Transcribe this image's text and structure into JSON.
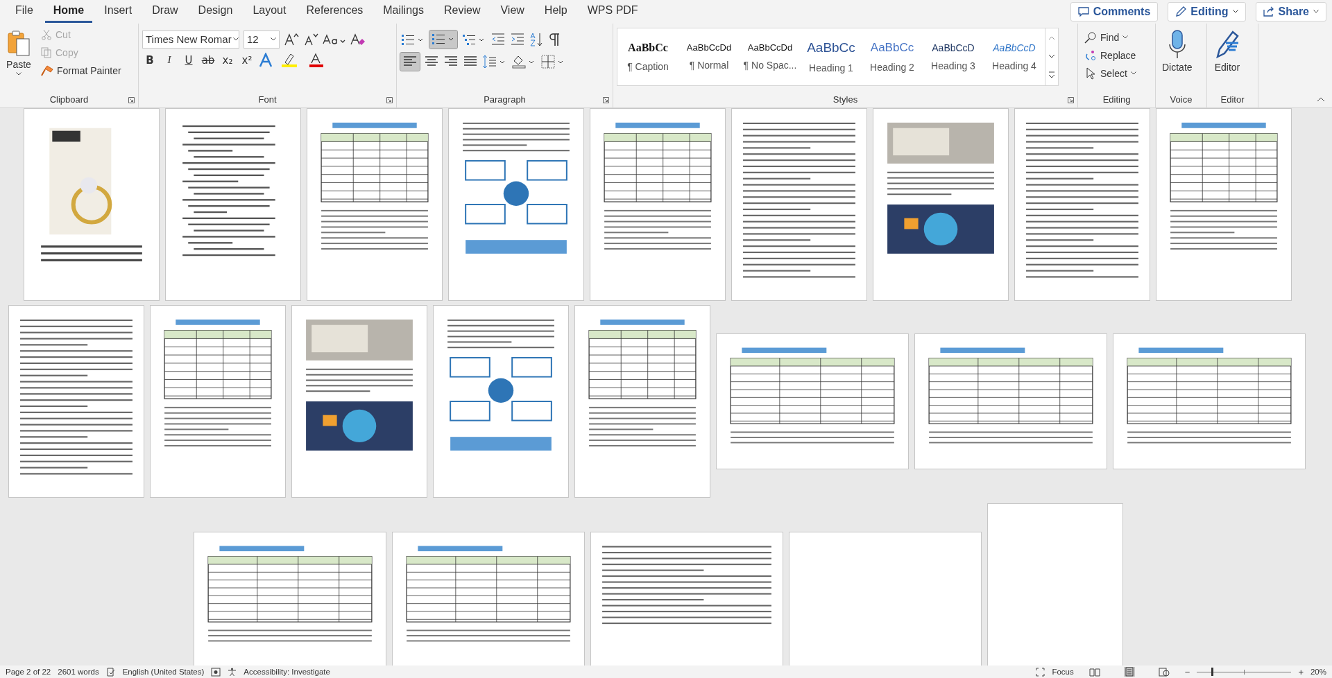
{
  "menu_tabs": [
    {
      "label": "File",
      "selected": false
    },
    {
      "label": "Home",
      "selected": true
    },
    {
      "label": "Insert",
      "selected": false
    },
    {
      "label": "Draw",
      "selected": false
    },
    {
      "label": "Design",
      "selected": false
    },
    {
      "label": "Layout",
      "selected": false
    },
    {
      "label": "References",
      "selected": false
    },
    {
      "label": "Mailings",
      "selected": false
    },
    {
      "label": "Review",
      "selected": false
    },
    {
      "label": "View",
      "selected": false
    },
    {
      "label": "Help",
      "selected": false
    },
    {
      "label": "WPS PDF",
      "selected": false
    }
  ],
  "header_buttons": [
    {
      "kind": "comments",
      "label": "Comments"
    },
    {
      "kind": "editing",
      "label": "Editing"
    },
    {
      "kind": "share",
      "label": "Share"
    }
  ],
  "clipboard": {
    "label": "Clipboard",
    "paste": "Paste",
    "cut": {
      "label": "Cut",
      "disabled": true
    },
    "copy": {
      "label": "Copy",
      "disabled": true
    },
    "format_painter": {
      "label": "Format Painter",
      "disabled": false
    }
  },
  "font": {
    "label": "Font",
    "name": "Times New Romar",
    "size": "12",
    "format_buttons": [
      {
        "kind": "bold",
        "label": "B"
      },
      {
        "kind": "italic",
        "label": "I"
      },
      {
        "kind": "underline",
        "label": "U"
      },
      {
        "kind": "strike",
        "label": "ab"
      },
      {
        "kind": "subscript",
        "label": "x₂"
      },
      {
        "kind": "superscript",
        "label": "x²"
      }
    ]
  },
  "paragraph": {
    "label": "Paragraph",
    "numbering_selected": true,
    "align_left_selected": true
  },
  "styles": {
    "label": "Styles",
    "items": [
      {
        "kind": "caption",
        "preview": "AaBbCc",
        "name": "¶ Caption"
      },
      {
        "kind": "normal",
        "preview": "AaBbCcDd",
        "name": "¶ Normal"
      },
      {
        "kind": "normal",
        "preview": "AaBbCcDd",
        "name": "¶ No Spac..."
      },
      {
        "kind": "heading1",
        "preview": "AaBbCc",
        "name": "Heading 1"
      },
      {
        "kind": "heading2",
        "preview": "AaBbCc",
        "name": "Heading 2"
      },
      {
        "kind": "heading3",
        "preview": "AaBbCcD",
        "name": "Heading 3"
      },
      {
        "kind": "heading4",
        "preview": "AaBbCcD",
        "name": "Heading 4"
      }
    ]
  },
  "editing": {
    "label": "Editing",
    "find": "Find",
    "replace": "Replace",
    "select": "Select"
  },
  "voice": {
    "label": "Voice",
    "dictate": "Dictate"
  },
  "editor": {
    "label": "Editor",
    "button": "Editor"
  },
  "page_rows": [
    [
      {
        "kind": "cover",
        "landscape": false
      },
      {
        "kind": "outline",
        "landscape": false
      },
      {
        "kind": "table",
        "landscape": false
      },
      {
        "kind": "diagram",
        "landscape": false
      },
      {
        "kind": "table",
        "landscape": false
      },
      {
        "kind": "text",
        "landscape": false
      },
      {
        "kind": "pictures",
        "landscape": false
      },
      {
        "kind": "text",
        "landscape": false
      },
      {
        "kind": "table",
        "landscape": false
      }
    ],
    [
      {
        "kind": "text",
        "landscape": false
      },
      {
        "kind": "table",
        "landscape": false
      },
      {
        "kind": "pictures",
        "landscape": false
      },
      {
        "kind": "diagram",
        "landscape": false
      },
      {
        "kind": "table",
        "landscape": false
      },
      {
        "kind": "table",
        "landscape": true
      },
      {
        "kind": "table",
        "landscape": true
      },
      {
        "kind": "table",
        "landscape": true
      }
    ],
    [
      {
        "kind": "table",
        "landscape": true
      },
      {
        "kind": "table",
        "landscape": true
      },
      {
        "kind": "text",
        "landscape": true
      },
      {
        "kind": "blank",
        "landscape": true
      },
      {
        "kind": "blank",
        "landscape": false
      }
    ]
  ],
  "status_bar": {
    "page": "Page 2 of 22",
    "words": "2601 words",
    "language": "English (United States)",
    "accessibility": "Accessibility: Investigate",
    "focus": "Focus",
    "zoom_out": "−",
    "zoom_in": "+",
    "zoom": "20%",
    "zoom_slider": {
      "level": 0.15
    }
  }
}
